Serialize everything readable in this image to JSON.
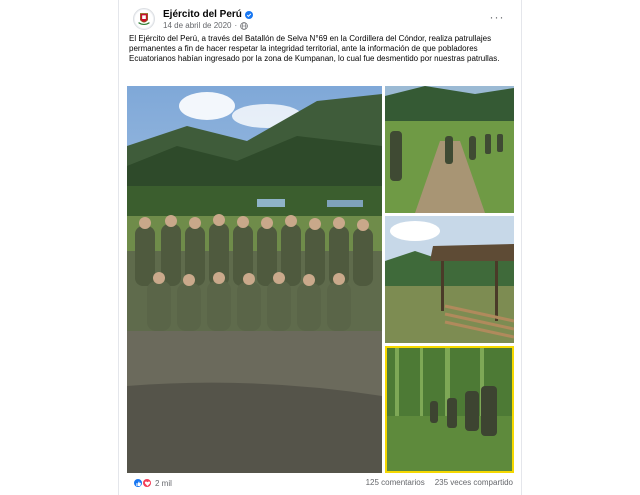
{
  "post": {
    "author": "Ejército del Perú",
    "date": "14 de abril de 2020",
    "date_separator": "·",
    "more_label": "···",
    "caption": "El Ejército del Perú, a través del Batallón de Selva N°69 en la Cordillera del Cóndor, realiza patrullajes permanentes a fin de hacer respetar la integridad territorial, ante la información de que pobladores Ecuatorianos habían ingresado por la zona de Kumpanan, lo cual fue desmentido por nuestras patrullas."
  },
  "footer": {
    "reaction_count": "2 mil",
    "comments": "125 comentarios",
    "shares": "235 veces compartido"
  },
  "colors": {
    "verified": "#1877f2",
    "highlight_border": "#f5d800"
  }
}
